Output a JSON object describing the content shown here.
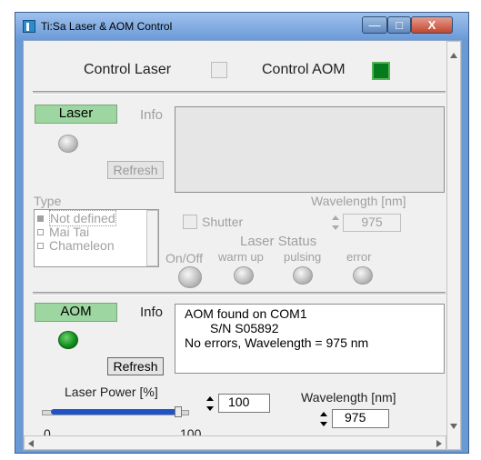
{
  "window": {
    "title": "Ti:Sa Laser & AOM Control",
    "controls": {
      "minimize": "—",
      "maximize": "□",
      "close": "X"
    }
  },
  "top": {
    "control_laser_label": "Control Laser",
    "control_laser_checked": false,
    "control_aom_label": "Control AOM",
    "control_aom_checked": true
  },
  "laser": {
    "tag": "Laser",
    "info_label": "Info",
    "info_text": "",
    "refresh_label": "Refresh",
    "type_label": "Type",
    "type_options": [
      "Not defined",
      "Mai Tai",
      "Chameleon"
    ],
    "type_selected": "Not defined",
    "shutter_label": "Shutter",
    "wavelength_label": "Wavelength [nm]",
    "wavelength_value": "975",
    "status_title": "Laser Status",
    "status_items": [
      "On/Off",
      "warm up",
      "pulsing",
      "error"
    ]
  },
  "aom": {
    "tag": "AOM",
    "info_label": "Info",
    "info_lines": [
      "AOM found on COM1",
      "S/N S05892",
      "No errors, Wavelength = 975 nm"
    ],
    "refresh_label": "Refresh",
    "power_label": "Laser Power [%]",
    "power_value": "100",
    "power_fraction": 1.0,
    "power_min_label": "0",
    "power_max_label": "100",
    "wavelength_label": "Wavelength [nm]",
    "wavelength_value": "975"
  },
  "colors": {
    "tag_green": "#9dd6a0",
    "aom_checked": "#087a1e",
    "slider_fill": "#1f52c6"
  }
}
